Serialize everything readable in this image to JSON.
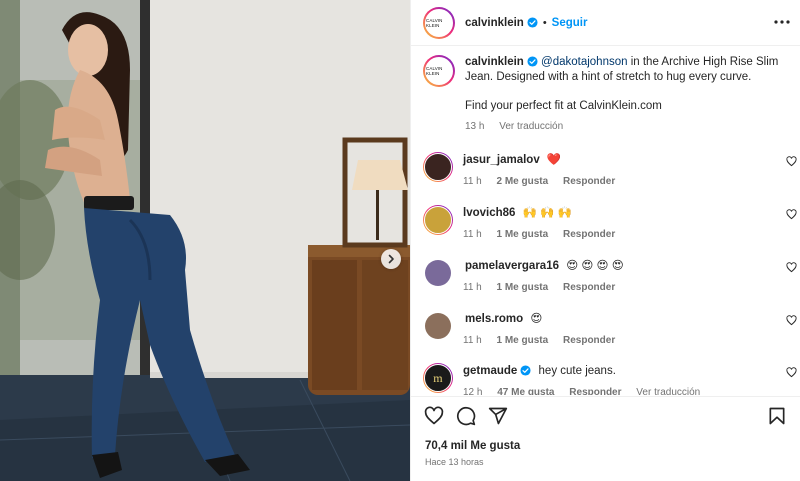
{
  "header": {
    "avatar_text": "CALVIN KLEIN",
    "username": "calvinklein",
    "separator": "•",
    "follow_label": "Seguir"
  },
  "caption": {
    "username": "calvinklein",
    "mention": "@dakotajohnson",
    "text_part1": " in the Archive High Rise Slim Jean. Designed with a hint of stretch to hug every curve.",
    "text_part2": "Find your perfect fit at CalvinKlein.com",
    "time": "13 h",
    "translate_label": "Ver traducción"
  },
  "comments": [
    {
      "username": "jasur_jamalov",
      "text": "❤️",
      "time": "11 h",
      "likes": "2 Me gusta",
      "reply": "Responder",
      "translate": ""
    },
    {
      "username": "lvovich86",
      "text": "🙌 🙌 🙌",
      "time": "11 h",
      "likes": "1 Me gusta",
      "reply": "Responder",
      "translate": ""
    },
    {
      "username": "pamelavergara16",
      "text": "😍 😍 😍 😍",
      "time": "11 h",
      "likes": "1 Me gusta",
      "reply": "Responder",
      "translate": ""
    },
    {
      "username": "mels.romo",
      "text": "😍",
      "time": "11 h",
      "likes": "1 Me gusta",
      "reply": "Responder",
      "translate": ""
    },
    {
      "username": "getmaude",
      "text": "hey cute jeans.",
      "time": "12 h",
      "likes": "47 Me gusta",
      "reply": "Responder",
      "translate": "Ver traducción",
      "avatar_letter": "m"
    }
  ],
  "footer": {
    "likes_count": "70,4 mil Me gusta",
    "time_ago": "Hace 13 horas"
  },
  "icons": {
    "like": "heart-icon",
    "comment": "comment-icon",
    "share": "share-icon",
    "save": "bookmark-icon",
    "more": "more-options-icon",
    "next": "chevron-right-icon",
    "verified": "verified-badge-icon"
  },
  "colors": {
    "accent": "#0095f6",
    "mention": "#00376b",
    "muted": "#737373",
    "heart_red": "#ed4956"
  }
}
